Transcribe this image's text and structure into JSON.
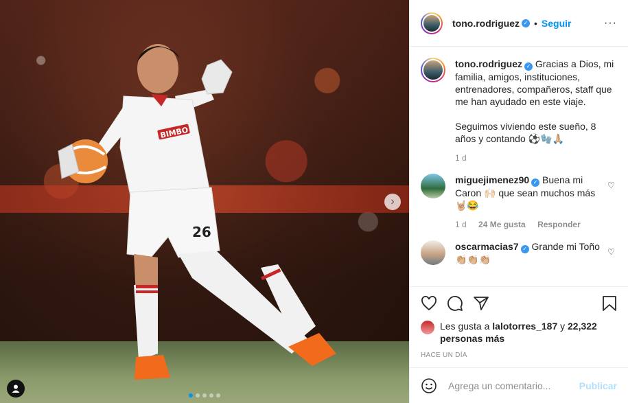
{
  "post": {
    "photo_dots": 5,
    "active_dot": 1
  },
  "header": {
    "username": "tono.rodriguez",
    "separator": "•",
    "follow_label": "Seguir",
    "more_label": "···"
  },
  "caption": {
    "username": "tono.rodriguez",
    "text_1": "Gracias a Dios, mi familia, amigos, instituciones, entrenadores, compañeros, staff que me han ayudado en este viaje.",
    "text_2": "Seguimos viviendo este sueño, 8 años y contando",
    "emojis": "⚽🧤🙏🏼",
    "time": "1 d"
  },
  "comments": [
    {
      "username": "miguejimenez90",
      "text_a": "Buena mi Caron",
      "emoji_a": "🙌🏻",
      "text_b": "que sean muchos más",
      "emoji_b": "🤘🏼😂",
      "time": "1 d",
      "likes": "24 Me gusta",
      "reply": "Responder"
    },
    {
      "username": "oscarmacias7",
      "text": "Grande mi Toño",
      "emoji": "👏🏼👏🏼👏🏼"
    }
  ],
  "likes": {
    "prefix": "Les gusta a",
    "user": "lalotorres_187",
    "connector": "y",
    "count": "22,322 personas más"
  },
  "timestamp": "HACE UN DÍA",
  "composer": {
    "placeholder": "Agrega un comentario...",
    "submit_label": "Publicar"
  },
  "colors": {
    "accent": "#0095f6",
    "verified": "#3897f0",
    "publish_disabled": "#b2dffc",
    "muted": "#8e8e8e"
  },
  "icons": [
    "user-tag-icon",
    "chevron-right-icon",
    "heart-icon",
    "comment-icon",
    "share-icon",
    "bookmark-icon",
    "emoji-icon",
    "verified-icon",
    "more-options-icon"
  ]
}
